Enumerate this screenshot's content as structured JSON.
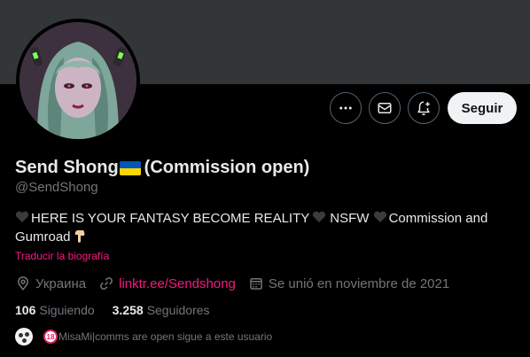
{
  "profile": {
    "display_name": "Send Shong",
    "name_suffix": "(Commission open)",
    "handle": "@SendShong",
    "bio_part1": "HERE IS YOUR FANTASY BECOME REALITY",
    "bio_part2": "NSFW",
    "bio_part3": "Commission and Gumroad",
    "translate_label": "Traducir la biografía",
    "location": "Украина",
    "website": "linktr.ee/Sendshong",
    "joined": "Se unió en noviembre de 2021"
  },
  "actions": {
    "more_icon": "more-icon",
    "message_icon": "envelope-icon",
    "notify_icon": "bell-plus-icon",
    "follow_label": "Seguir"
  },
  "stats": {
    "following_count": "106",
    "following_label": "Siguiendo",
    "followers_count": "3.258",
    "followers_label": "Seguidores"
  },
  "followed_by": {
    "badge": "18",
    "text": "MisaMi|comms are open sigue a este usuario"
  },
  "colors": {
    "background": "#000000",
    "banner": "#333639",
    "accent_link": "#f91880",
    "muted_text": "#71767b",
    "primary_text": "#e7e9ea",
    "flag_blue": "#0057b7",
    "flag_yellow": "#ffd700"
  }
}
